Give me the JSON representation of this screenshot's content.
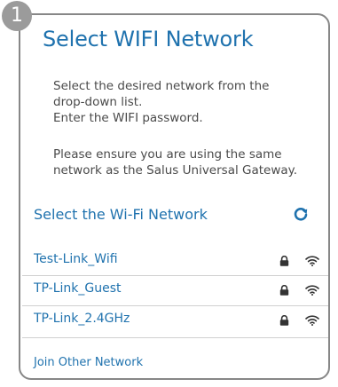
{
  "step": {
    "number": "1"
  },
  "dialog": {
    "title": "Select WIFI Network",
    "instructions": [
      "Select the desired network from the",
      "drop-down list.",
      "Enter the WIFI password."
    ],
    "note": [
      "Please ensure you are using the same",
      "network as the Salus Universal Gateway."
    ]
  },
  "network_section": {
    "label": "Select the Wi-Fi Network",
    "refresh_icon": "refresh-icon"
  },
  "networks": [
    {
      "name": "Test-Link_Wifi",
      "secured": true,
      "icons": [
        "lock-icon",
        "wifi-icon"
      ]
    },
    {
      "name": "TP-Link_Guest",
      "secured": true,
      "icons": [
        "lock-icon",
        "wifi-icon"
      ]
    },
    {
      "name": "TP-Link_2.4GHz",
      "secured": true,
      "icons": [
        "lock-icon",
        "wifi-icon"
      ]
    }
  ],
  "join_other": "Join Other Network",
  "colors": {
    "accent": "#1f72ae",
    "text": "#4a4a4a",
    "border": "#878787",
    "badge": "#9b9b9b"
  }
}
